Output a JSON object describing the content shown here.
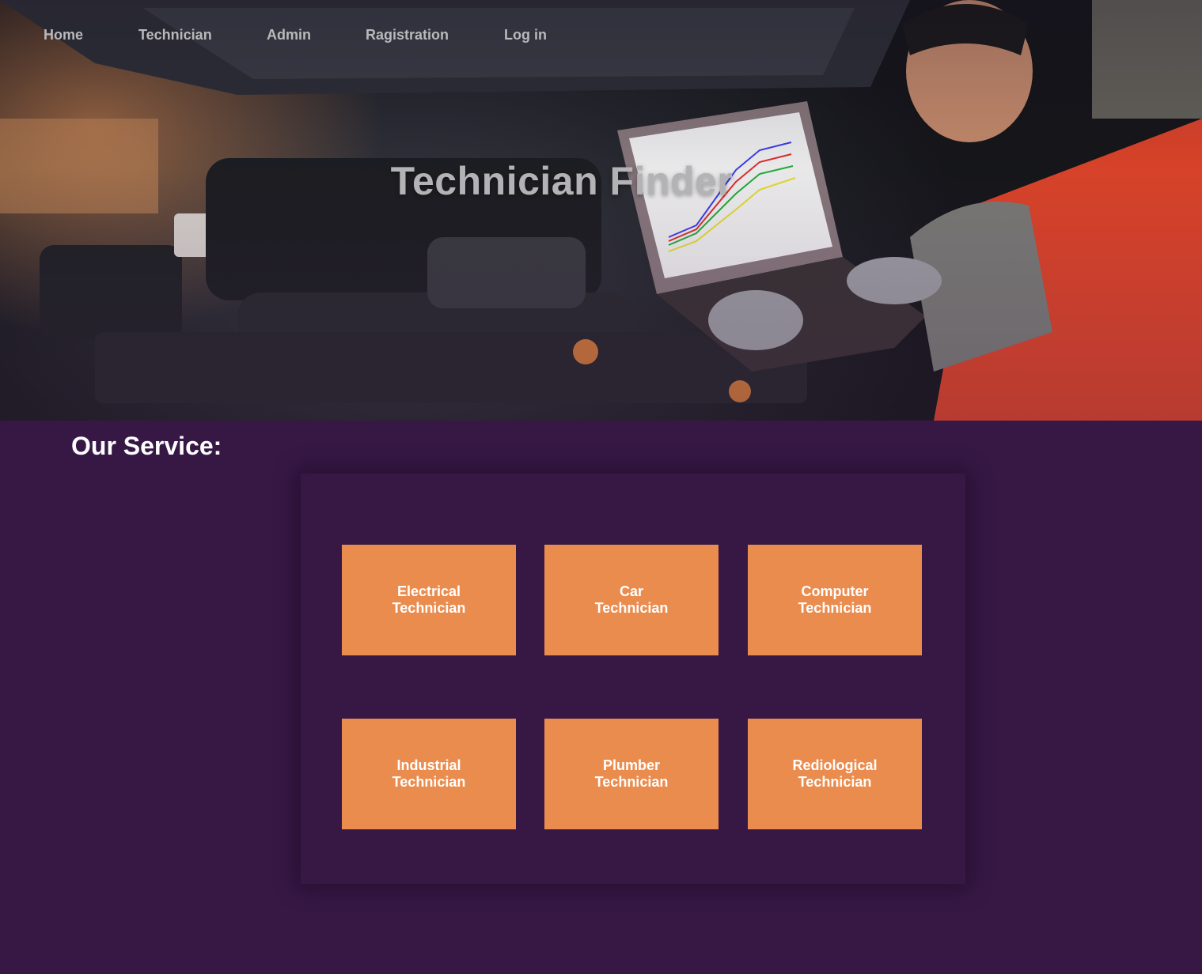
{
  "nav": {
    "items": [
      {
        "label": "Home"
      },
      {
        "label": "Technician"
      },
      {
        "label": "Admin"
      },
      {
        "label": "Ragistration"
      },
      {
        "label": "Log in"
      }
    ]
  },
  "hero": {
    "title": "Technician Finder"
  },
  "services": {
    "heading": "Our Service:",
    "items": [
      {
        "line1": "Electrical",
        "line2": "Technician"
      },
      {
        "line1": "Car",
        "line2": "Technician"
      },
      {
        "line1": "Computer",
        "line2": "Technician"
      },
      {
        "line1": "Industrial",
        "line2": "Technician"
      },
      {
        "line1": "Plumber",
        "line2": "Technician"
      },
      {
        "line1": "Rediological",
        "line2": "Technician"
      }
    ]
  },
  "colors": {
    "background": "#371845",
    "tile": "#eb8c4f",
    "nav_text": "#b9b9bb"
  }
}
